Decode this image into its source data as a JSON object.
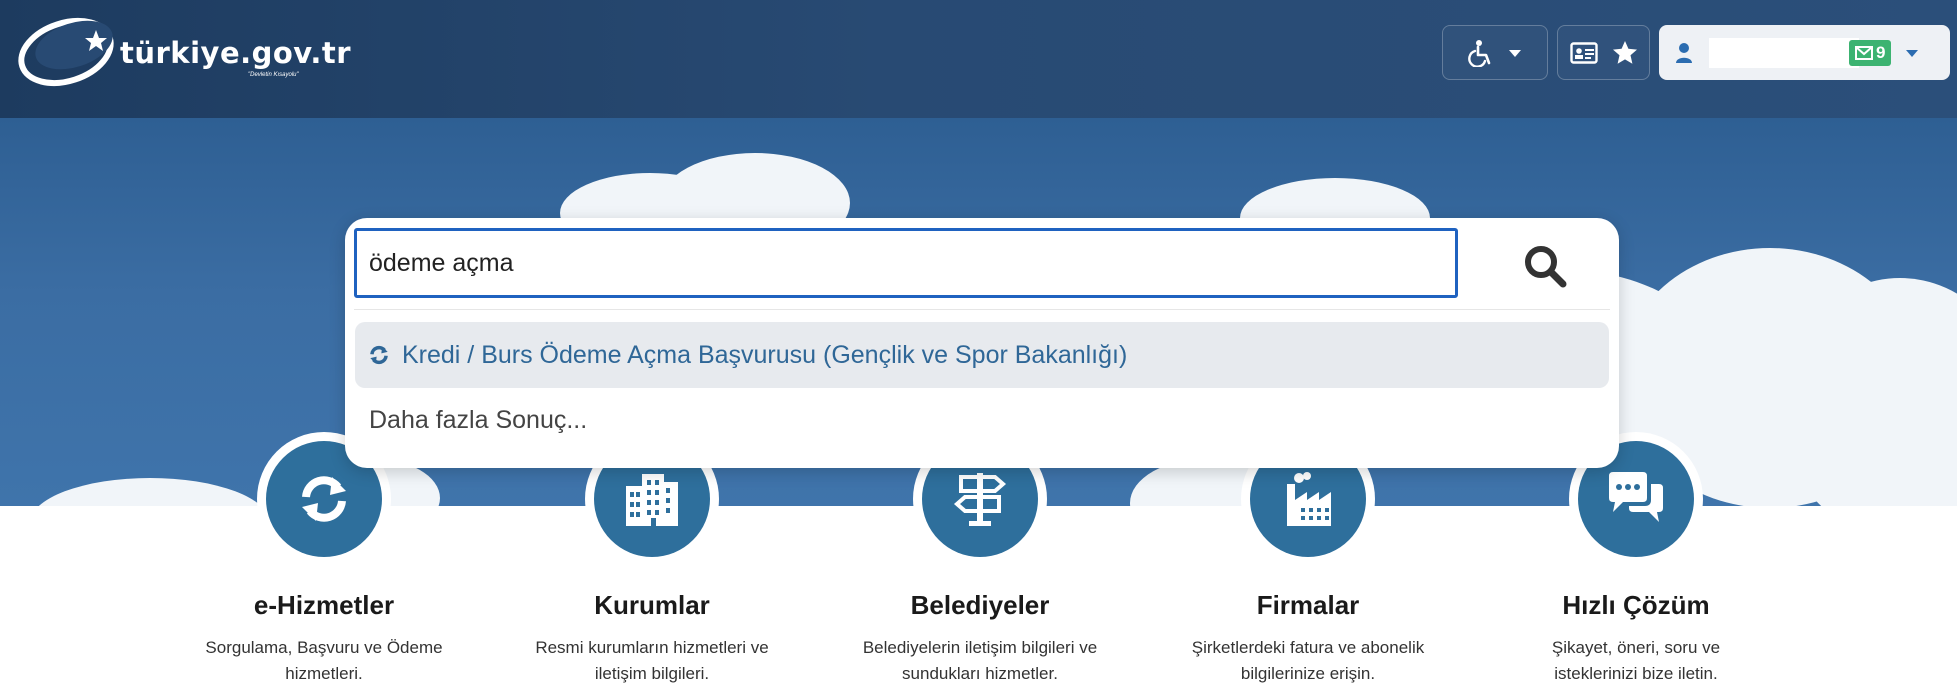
{
  "header": {
    "logo_text": "türkiye.gov.tr",
    "logo_motto": "\"Devletin Kısayolu\"",
    "message_count": "9"
  },
  "search": {
    "query": "ödeme açma",
    "suggestions": [
      {
        "label": "Kredi / Burs Ödeme Açma Başvurusu (Gençlik ve Spor Bakanlığı)"
      }
    ],
    "more_results_label": "Daha fazla Sonuç..."
  },
  "features": [
    {
      "title": "e-Hizmetler",
      "desc_line1": "Sorgulama, Başvuru ve Ödeme",
      "desc_line2": "hizmetleri.",
      "icon": "refresh-icon"
    },
    {
      "title": "Kurumlar",
      "desc_line1": "Resmi kurumların hizmetleri ve",
      "desc_line2": "iletişim bilgileri.",
      "icon": "building-icon"
    },
    {
      "title": "Belediyeler",
      "desc_line1": "Belediyelerin iletişim bilgileri ve",
      "desc_line2": "sundukları hizmetler.",
      "icon": "signpost-icon"
    },
    {
      "title": "Firmalar",
      "desc_line1": "Şirketlerdeki fatura ve abonelik",
      "desc_line2": "bilgilerinize erişin.",
      "icon": "factory-icon"
    },
    {
      "title": "Hızlı Çözüm",
      "desc_line1": "Şikayet, öneri, soru ve",
      "desc_line2": "isteklerinizi bize iletin.",
      "icon": "chat-icon"
    }
  ],
  "colors": {
    "header_bg": "#284a73",
    "accent_blue": "#2e6f9c",
    "link_blue": "#2f6797",
    "badge_green": "#3cb371",
    "input_border": "#1f62c0"
  }
}
